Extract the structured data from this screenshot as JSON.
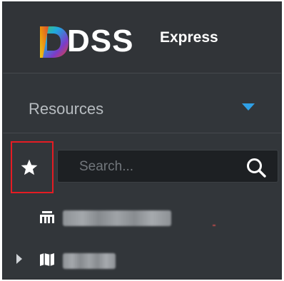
{
  "app": {
    "logo_primary": "DSS",
    "logo_secondary": "Express"
  },
  "resources": {
    "label": "Resources",
    "dropdown_icon": "caret-down-icon",
    "dropdown_color": "#2fa0e6"
  },
  "toolbar": {
    "favorites_icon": "star-icon",
    "highlight_color": "#e51c23"
  },
  "search": {
    "placeholder": "Search...",
    "value": "",
    "icon": "search-icon"
  },
  "tree": {
    "items": [
      {
        "icon": "organization-icon",
        "label": "████████",
        "expandable": false
      },
      {
        "icon": "map-icon",
        "label": "███",
        "expandable": true
      }
    ]
  }
}
